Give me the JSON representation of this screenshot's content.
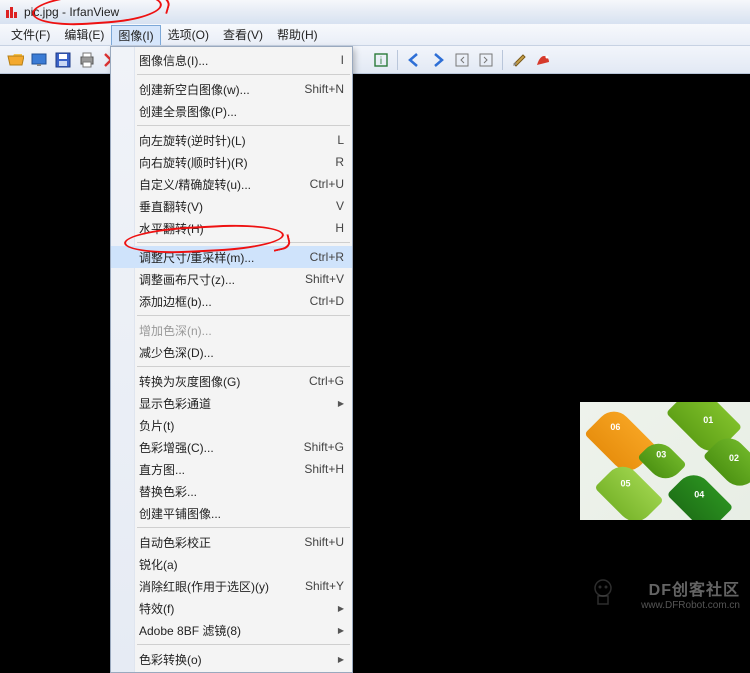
{
  "window": {
    "filename": "pic.jpg",
    "app": "IrfanView",
    "title": "pic.jpg - IrfanView"
  },
  "menubar": [
    {
      "label": "文件(F)"
    },
    {
      "label": "编辑(E)"
    },
    {
      "label": "图像(I)",
      "open": true
    },
    {
      "label": "选项(O)"
    },
    {
      "label": "查看(V)"
    },
    {
      "label": "帮助(H)"
    }
  ],
  "dropdown": {
    "groups": [
      [
        {
          "label": "图像信息(I)...",
          "shortcut": "I"
        }
      ],
      [
        {
          "label": "创建新空白图像(w)...",
          "shortcut": "Shift+N"
        },
        {
          "label": "创建全景图像(P)..."
        }
      ],
      [
        {
          "label": "向左旋转(逆时针)(L)",
          "shortcut": "L"
        },
        {
          "label": "向右旋转(顺时针)(R)",
          "shortcut": "R"
        },
        {
          "label": "自定义/精确旋转(u)...",
          "shortcut": "Ctrl+U"
        },
        {
          "label": "垂直翻转(V)",
          "shortcut": "V"
        },
        {
          "label": "水平翻转(H)",
          "shortcut": "H"
        }
      ],
      [
        {
          "label": "调整尺寸/重采样(m)...",
          "shortcut": "Ctrl+R",
          "hl": true
        },
        {
          "label": "调整画布尺寸(z)...",
          "shortcut": "Shift+V"
        },
        {
          "label": "添加边框(b)...",
          "shortcut": "Ctrl+D"
        }
      ],
      [
        {
          "label": "增加色深(n)...",
          "disabled": true
        },
        {
          "label": "减少色深(D)..."
        }
      ],
      [
        {
          "label": "转换为灰度图像(G)",
          "shortcut": "Ctrl+G"
        },
        {
          "label": "显示色彩通道",
          "submenu": true
        },
        {
          "label": "负片(t)"
        },
        {
          "label": "色彩增强(C)...",
          "shortcut": "Shift+G"
        },
        {
          "label": "直方图...",
          "shortcut": "Shift+H"
        },
        {
          "label": "替换色彩..."
        },
        {
          "label": "创建平铺图像..."
        }
      ],
      [
        {
          "label": "自动色彩校正",
          "shortcut": "Shift+U"
        },
        {
          "label": "锐化(a)"
        },
        {
          "label": "消除红眼(作用于选区)(y)",
          "shortcut": "Shift+Y"
        },
        {
          "label": "特效(f)",
          "submenu": true
        },
        {
          "label": "Adobe 8BF 滤镜(8)",
          "submenu": true
        }
      ],
      [
        {
          "label": "色彩转换(o)",
          "submenu": true
        }
      ]
    ]
  },
  "promo": {
    "leaves": [
      {
        "num": "06"
      },
      {
        "num": "01"
      },
      {
        "num": "05"
      },
      {
        "num": "02"
      },
      {
        "num": "04"
      },
      {
        "num": "03"
      }
    ]
  },
  "watermark": {
    "brand": "DF创客社区",
    "url": "www.DFRobot.com.cn"
  }
}
